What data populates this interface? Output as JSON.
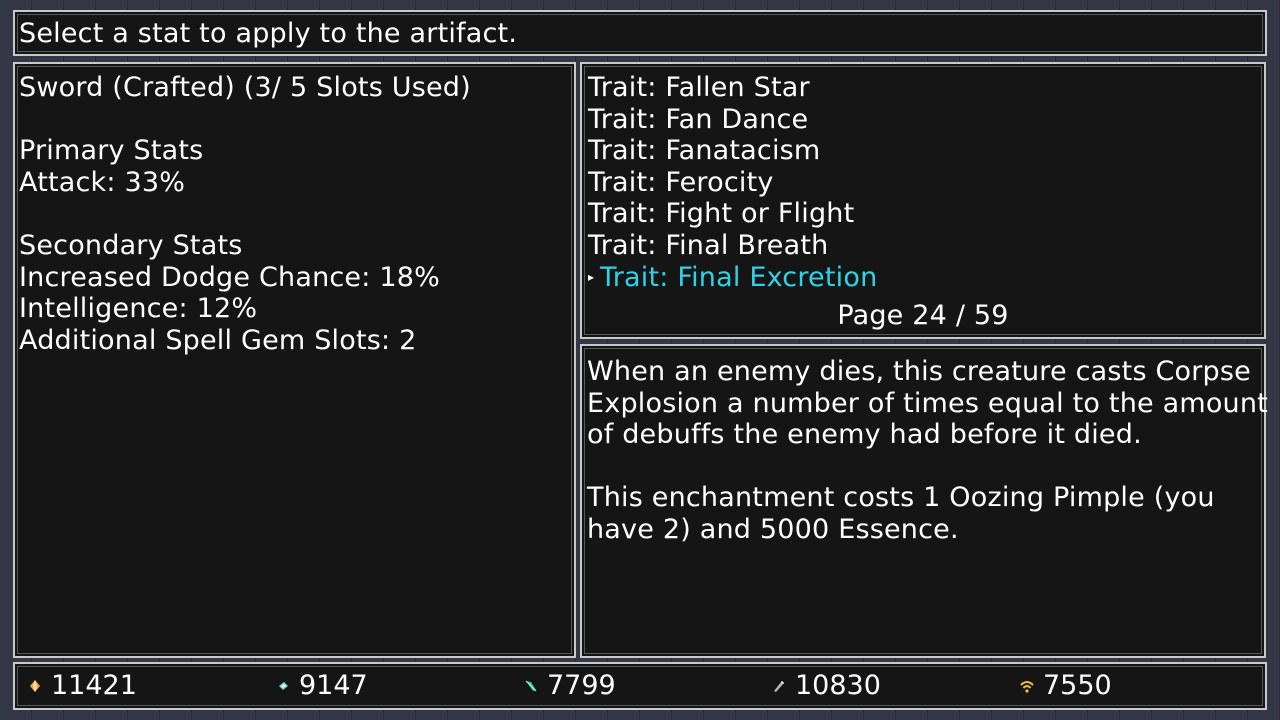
{
  "prompt": "Select a stat to apply to the artifact.",
  "artifact": {
    "title": "Sword (Crafted) (3/ 5 Slots Used)",
    "primary_heading": "Primary Stats",
    "primary_stats": [
      "Attack: 33%"
    ],
    "secondary_heading": "Secondary Stats",
    "secondary_stats": [
      "Increased Dodge Chance: 18%",
      "Intelligence: 12%",
      "Additional Spell Gem Slots: 2"
    ]
  },
  "traits": {
    "items": [
      "Trait: Fallen Star",
      "Trait: Fan Dance",
      "Trait: Fanatacism",
      "Trait: Ferocity",
      "Trait: Fight or Flight",
      "Trait: Final Breath",
      "Trait: Final Excretion"
    ],
    "selected_index": 6,
    "page": "Page 24 / 59",
    "selected_color": "#2fd3e6"
  },
  "description": {
    "effect": "When an enemy dies, this creature casts Corpse\nExplosion a number of times equal to the amount\nof debuffs the enemy had before it died.",
    "cost": "This enchantment costs 1 Oozing Pimple (you\nhave 2) and 5000 Essence."
  },
  "currencies": [
    {
      "icon": "orange-gem-icon",
      "value": "11421"
    },
    {
      "icon": "teal-crystal-icon",
      "value": "9147"
    },
    {
      "icon": "green-leaf-icon",
      "value": "7799"
    },
    {
      "icon": "gray-shard-icon",
      "value": "10830"
    },
    {
      "icon": "gold-signal-icon",
      "value": "7550"
    }
  ]
}
